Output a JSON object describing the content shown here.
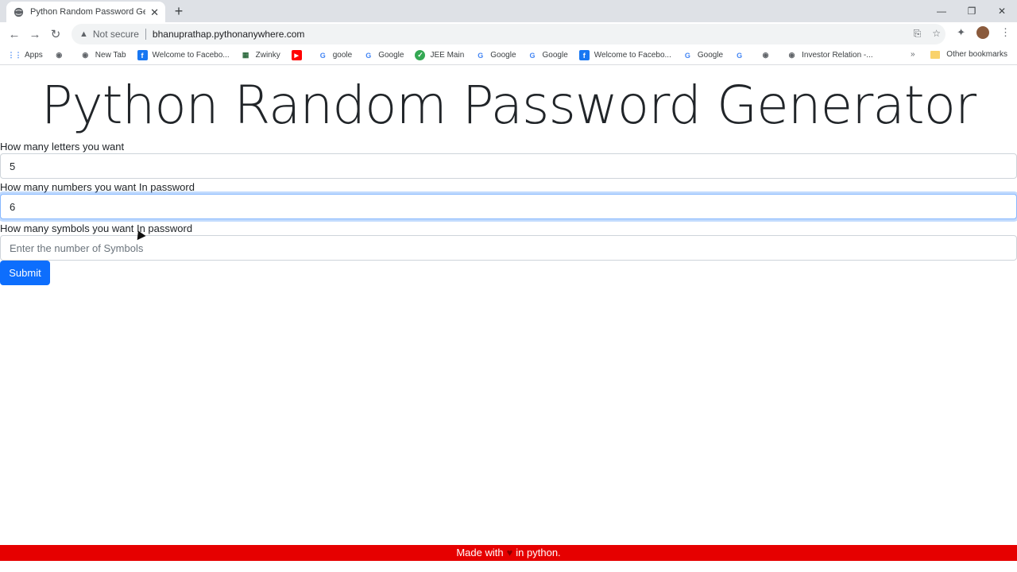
{
  "browser": {
    "tab_title": "Python Random Password Gener",
    "url_warning": "Not secure",
    "url": "bhanuprathap.pythonanywhere.com",
    "bookmarks": [
      {
        "label": "Apps",
        "icon": "apps-icon",
        "color": "#4285f4"
      },
      {
        "label": "",
        "icon": "globe-icon",
        "color": "#5f6368"
      },
      {
        "label": "New Tab",
        "icon": "globe-icon",
        "color": "#5f6368"
      },
      {
        "label": "Welcome to Facebo...",
        "icon": "facebook-icon",
        "color": "#1877f2"
      },
      {
        "label": "Zwinky",
        "icon": "zwinky-icon",
        "color": "#2d6a3e"
      },
      {
        "label": "",
        "icon": "youtube-icon",
        "color": "#ff0000"
      },
      {
        "label": "goole",
        "icon": "google-icon",
        "color": "#4285f4"
      },
      {
        "label": "Google",
        "icon": "google-icon",
        "color": "#4285f4"
      },
      {
        "label": "JEE Main",
        "icon": "jee-icon",
        "color": "#34a853"
      },
      {
        "label": "Google",
        "icon": "google-icon",
        "color": "#4285f4"
      },
      {
        "label": "Google",
        "icon": "google-icon",
        "color": "#4285f4"
      },
      {
        "label": "Welcome to Facebo...",
        "icon": "facebook-icon",
        "color": "#1877f2"
      },
      {
        "label": "Google",
        "icon": "google-icon",
        "color": "#4285f4"
      },
      {
        "label": "",
        "icon": "google-icon",
        "color": "#4285f4"
      },
      {
        "label": "",
        "icon": "globe-icon",
        "color": "#5f6368"
      },
      {
        "label": "Investor Relation -...",
        "icon": "globe-icon",
        "color": "#5f6368"
      }
    ],
    "more": "»",
    "other_bookmarks": "Other bookmarks"
  },
  "page": {
    "title": "Python Random Password Generator",
    "letters_label": "How many letters you want",
    "letters_value": "5",
    "numbers_label": "How many numbers you want In password",
    "numbers_value": "6",
    "symbols_label": "How many symbols you want In password",
    "symbols_placeholder": "Enter the number of Symbols",
    "submit_label": "Submit"
  },
  "footer": {
    "prefix": "Made with",
    "suffix": "in python."
  },
  "colors": {
    "accent": "#0d6efd",
    "footer": "#e60000"
  }
}
